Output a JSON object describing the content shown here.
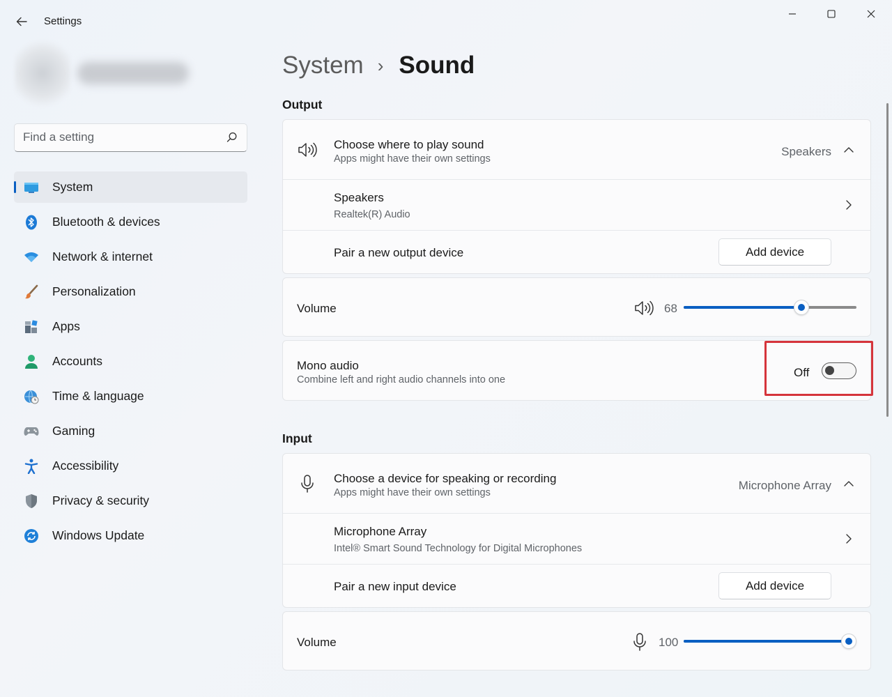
{
  "window": {
    "title": "Settings",
    "controls": [
      "minimize",
      "maximize",
      "close"
    ]
  },
  "search": {
    "placeholder": "Find a setting"
  },
  "sidebar": {
    "items": [
      {
        "label": "System",
        "icon": "system-icon",
        "active": true
      },
      {
        "label": "Bluetooth & devices",
        "icon": "bluetooth-icon",
        "active": false
      },
      {
        "label": "Network & internet",
        "icon": "wifi-icon",
        "active": false
      },
      {
        "label": "Personalization",
        "icon": "paintbrush-icon",
        "active": false
      },
      {
        "label": "Apps",
        "icon": "apps-icon",
        "active": false
      },
      {
        "label": "Accounts",
        "icon": "accounts-icon",
        "active": false
      },
      {
        "label": "Time & language",
        "icon": "globe-clock-icon",
        "active": false
      },
      {
        "label": "Gaming",
        "icon": "gamepad-icon",
        "active": false
      },
      {
        "label": "Accessibility",
        "icon": "accessibility-icon",
        "active": false
      },
      {
        "label": "Privacy & security",
        "icon": "shield-icon",
        "active": false
      },
      {
        "label": "Windows Update",
        "icon": "update-icon",
        "active": false
      }
    ]
  },
  "breadcrumb": {
    "parent": "System",
    "separator": "›",
    "current": "Sound"
  },
  "output": {
    "section_title": "Output",
    "choose": {
      "title": "Choose where to play sound",
      "subtitle": "Apps might have their own settings",
      "value": "Speakers"
    },
    "device": {
      "title": "Speakers",
      "subtitle": "Realtek(R) Audio"
    },
    "pair": {
      "title": "Pair a new output device",
      "button": "Add device"
    },
    "volume": {
      "label": "Volume",
      "value": "68",
      "level": 0.68
    },
    "mono": {
      "title": "Mono audio",
      "subtitle": "Combine left and right audio channels into one",
      "state": "Off"
    }
  },
  "input": {
    "section_title": "Input",
    "choose": {
      "title": "Choose a device for speaking or recording",
      "subtitle": "Apps might have their own settings",
      "value": "Microphone Array"
    },
    "device": {
      "title": "Microphone Array",
      "subtitle": "Intel® Smart Sound Technology for Digital Microphones"
    },
    "pair": {
      "title": "Pair a new input device",
      "button": "Add device"
    },
    "volume": {
      "label": "Volume",
      "value": "100",
      "level": 1.0
    }
  },
  "colors": {
    "accent": "#0a5fc2",
    "highlight": "#d5343b"
  }
}
